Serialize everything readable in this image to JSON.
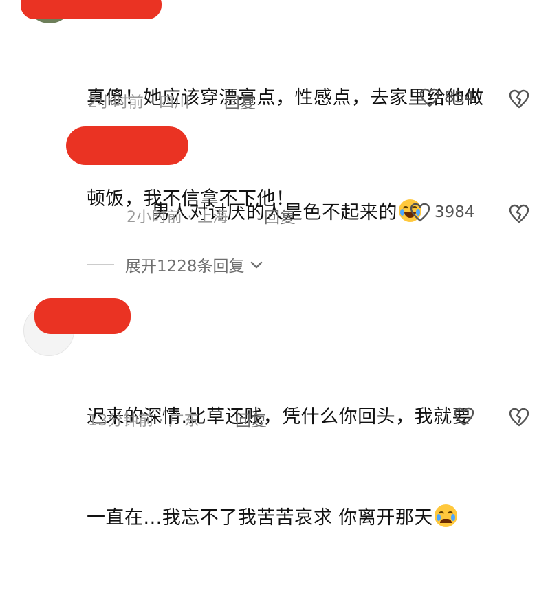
{
  "colors": {
    "redaction": "#ea3323",
    "meta_text": "#9a9a9a",
    "main_text": "#121212"
  },
  "comments": [
    {
      "text_line1": "真傻！她应该穿漂亮点，性感点，去家里给他做",
      "text_line2": "顿饭，我不信拿不下他！",
      "meta": "2小时前 · 四川",
      "reply_label": "回复",
      "like_count": "854"
    },
    {
      "text": "男人对讨厌的人是色不起来的",
      "emoji": "laughing-crying-emoji",
      "meta": "2小时前 · 上海",
      "reply_label": "回复",
      "like_count": "3984"
    },
    {
      "text_line1": "迟来的深情.比草还贱，凭什么你回头，我就要",
      "text_line2": "一直在...我忘不了我苦苦哀求 你离开那天",
      "emoji": "crying-emoji",
      "meta": "13分钟前 · 广东",
      "reply_label": "回复",
      "like_count": ""
    }
  ],
  "expand_replies": {
    "label": "展开1228条回复"
  }
}
